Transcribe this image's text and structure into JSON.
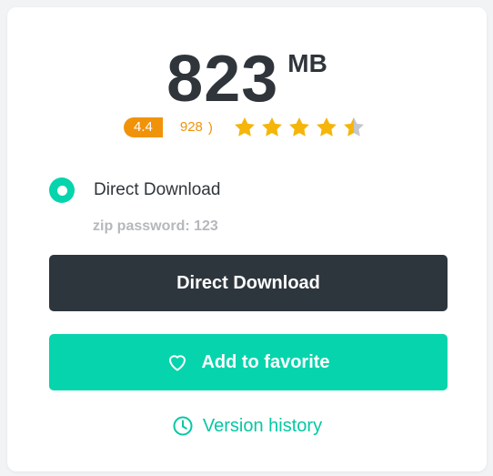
{
  "file": {
    "size_value": "823",
    "size_unit": "MB"
  },
  "rating": {
    "score": "4.4",
    "count": "928",
    "close_bracket": ")",
    "stars": 4.4,
    "max_stars": 5
  },
  "download_options": {
    "selected_label": "Direct Download",
    "note": "zip password: 123"
  },
  "buttons": {
    "download_label": "Direct Download",
    "favorite_label": "Add to favorite"
  },
  "links": {
    "version_history_label": "Version history"
  },
  "colors": {
    "accent": "#06d4ad",
    "dark": "#2e363d",
    "star": "#f5b50a",
    "rating_badge": "#f0930a"
  }
}
